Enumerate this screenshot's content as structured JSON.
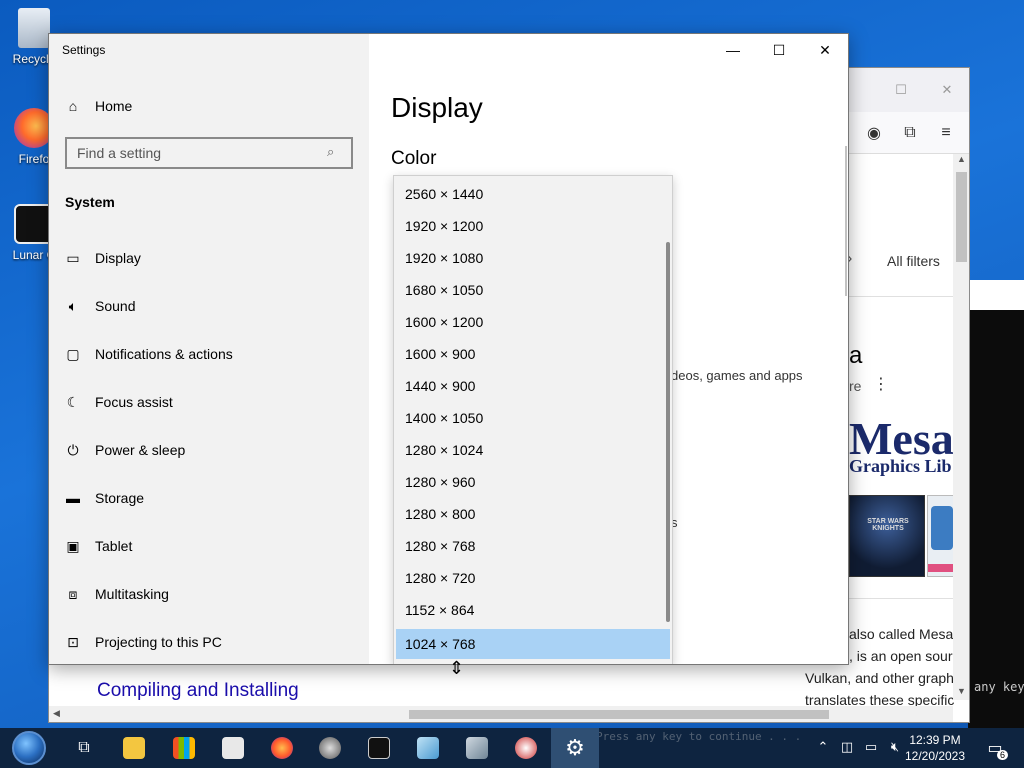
{
  "desktop": {
    "icons": [
      {
        "label": "Recycle"
      },
      {
        "label": "Firefo"
      },
      {
        "label": "Lunar C"
      }
    ]
  },
  "console": {
    "text": "any key"
  },
  "browser": {
    "filters_label": "All filters",
    "mesa_heading": "a",
    "more_label": "re",
    "logo_big": "Mesa",
    "logo_small": "Graphics Lib",
    "thumb_game": "STAR WARS KNIGHTS",
    "snippet_1": "also called Mesa",
    "snippet_2": ", is an open sour",
    "snippet_3": "Vulkan, and other graph",
    "snippet_4": "translates these specific",
    "section_link": "Compiling and Installing"
  },
  "settings": {
    "window_title": "Settings",
    "search_placeholder": "Find a setting",
    "home_label": "Home",
    "section": "System",
    "nav": [
      {
        "label": "Display",
        "icon": "monitor-icon"
      },
      {
        "label": "Sound",
        "icon": "speaker-icon"
      },
      {
        "label": "Notifications & actions",
        "icon": "message-icon"
      },
      {
        "label": "Focus assist",
        "icon": "moon-icon"
      },
      {
        "label": "Power & sleep",
        "icon": "power-icon"
      },
      {
        "label": "Storage",
        "icon": "drive-icon"
      },
      {
        "label": "Tablet",
        "icon": "tablet-icon"
      },
      {
        "label": "Multitasking",
        "icon": "multitask-icon"
      },
      {
        "label": "Projecting to this PC",
        "icon": "project-icon"
      }
    ],
    "page_title": "Display",
    "sub_title": "Color",
    "hidden_text": "deos, games and apps",
    "hidden_s": "s",
    "resolution_options": [
      "2560 × 1440",
      "1920 × 1200",
      "1920 × 1080",
      "1680 × 1050",
      "1600 × 1200",
      "1600 × 900",
      "1440 × 900",
      "1400 × 1050",
      "1280 × 1024",
      "1280 × 960",
      "1280 × 800",
      "1280 × 768",
      "1280 × 720",
      "1152 × 864",
      "1024 × 768"
    ],
    "selected_resolution": "1024 × 768"
  },
  "taskbar": {
    "time": "12:39 PM",
    "date": "12/20/2023",
    "notification_count": "6",
    "background_text": "Press any key to continue . . ."
  },
  "colors": {
    "selection": "#a9d2f5",
    "sidebar_bg": "#f2f2f2",
    "taskbar_bg": "#0e2440",
    "link": "#1a0dab"
  }
}
